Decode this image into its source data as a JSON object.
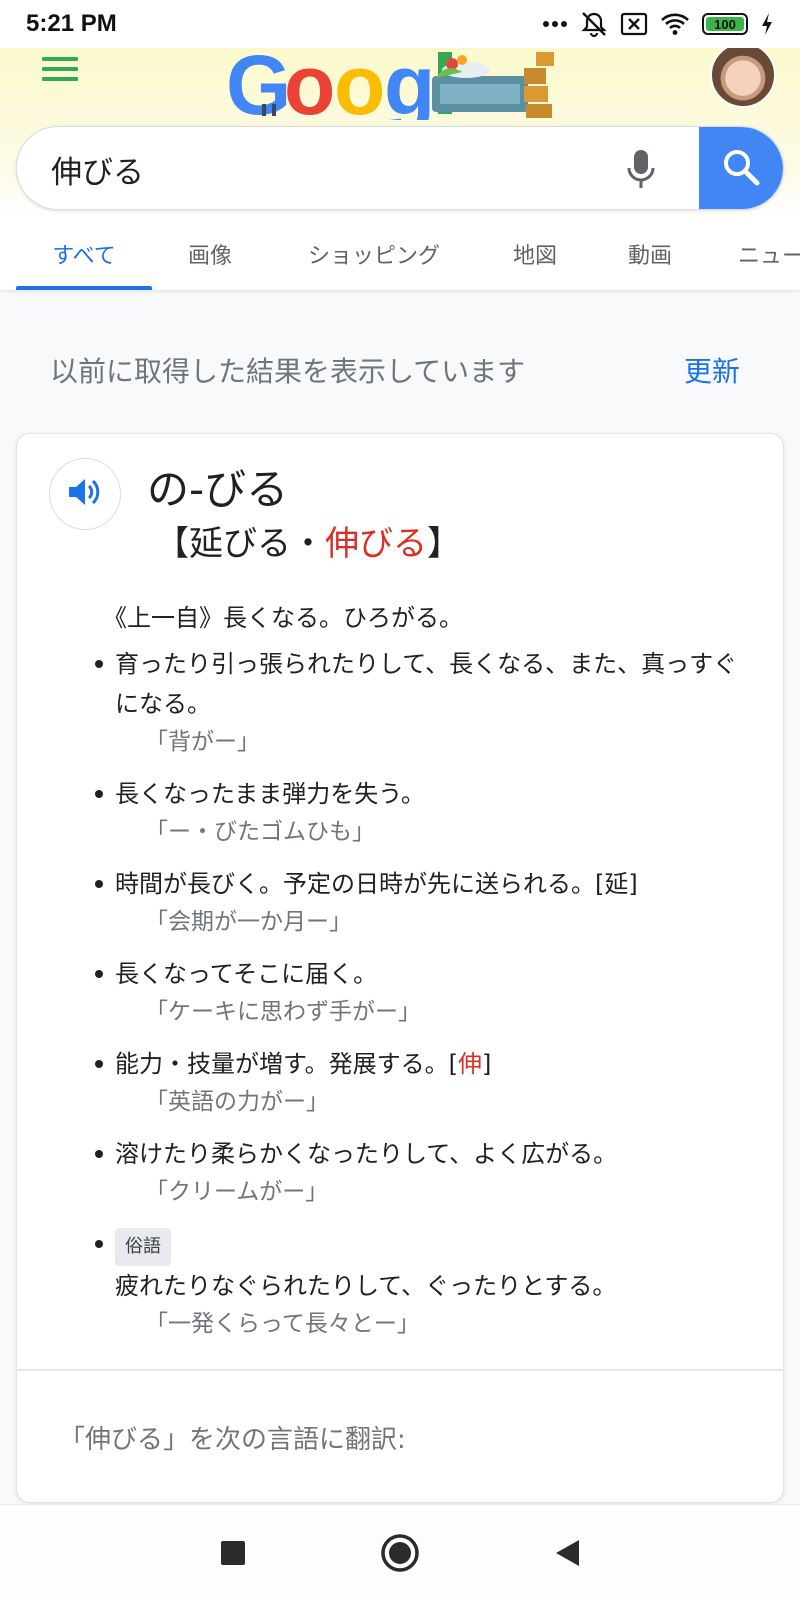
{
  "status_bar": {
    "time": "5:21 PM",
    "battery": "100",
    "icons": [
      "more-dots-icon",
      "bell-off-icon",
      "sim-x-icon",
      "wifi-icon",
      "battery-icon",
      "charging-bolt-icon"
    ]
  },
  "header": {
    "logo_text": "Google",
    "menu_icon": "hamburger-menu-icon",
    "avatar_icon": "user-avatar"
  },
  "search": {
    "query": "伸びる",
    "mic_icon": "mic-icon",
    "search_icon": "search-icon",
    "accent": "#4285f4"
  },
  "tabs": [
    {
      "label": "すべて",
      "active": true
    },
    {
      "label": "画像",
      "active": false
    },
    {
      "label": "ショッピング",
      "active": false
    },
    {
      "label": "地図",
      "active": false
    },
    {
      "label": "動画",
      "active": false
    },
    {
      "label": "ニュース",
      "active": false
    }
  ],
  "notice": {
    "text": "以前に取得した結果を表示しています",
    "action": "更新"
  },
  "dictionary": {
    "headword": "の-びる",
    "bracket_open": "【",
    "variant_1": "延びる",
    "separator": "・",
    "variant_2": "伸びる",
    "bracket_close": "】",
    "highlight_color": "#d93025",
    "pos": "《上一自》長くなる。ひろがる。",
    "definitions": [
      {
        "text": "育ったり引っ張られたりして、長くなる、また、真っすぐになる。",
        "example": "「背がー」"
      },
      {
        "text": "長くなったまま弾力を失う。",
        "example": "「ー・びたゴムひも」"
      },
      {
        "text": "時間が長びく。予定の日時が先に送られる。",
        "ref": "[延]",
        "example": "「会期が一か月ー」"
      },
      {
        "text": "長くなってそこに届く。",
        "example": "「ケーキに思わず手がー」"
      },
      {
        "text": "能力・技量が増す。発展する。",
        "ref_open": "[",
        "ref_char": "伸",
        "ref_close": "]",
        "example": "「英語の力がー」"
      },
      {
        "text": "溶けたり柔らかくなったりして、よく広がる。",
        "example": "「クリームがー」"
      },
      {
        "badge": "俗語",
        "text": "疲れたりなぐられたりして、ぐったりとする。",
        "example": "「一発くらって長々とー」"
      }
    ],
    "translate_heading": "「伸びる」を次の言語に翻訳:"
  },
  "nav_bar": {
    "buttons": [
      "recents-square-icon",
      "home-circle-icon",
      "back-triangle-icon"
    ]
  }
}
